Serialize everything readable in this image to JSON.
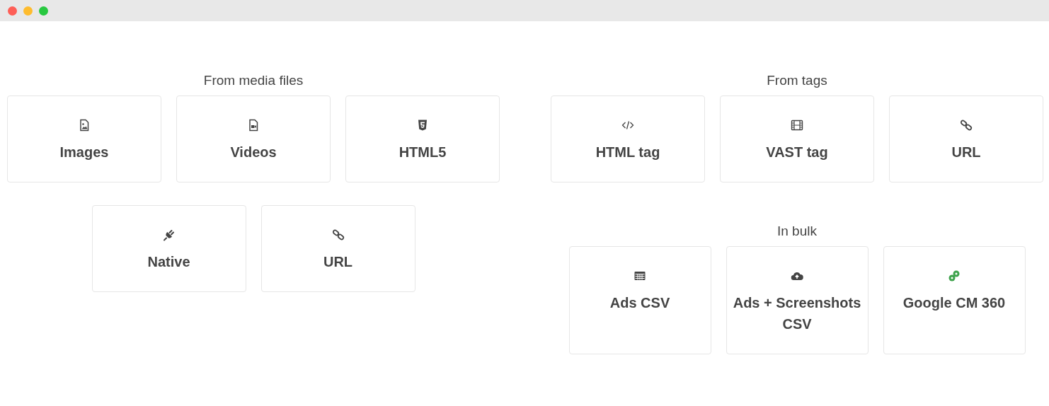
{
  "media_files": {
    "heading": "From media files",
    "rows": [
      [
        {
          "label": "Images",
          "kind": "image"
        },
        {
          "label": "Videos",
          "kind": "video"
        },
        {
          "label": "HTML5",
          "kind": "html5"
        }
      ],
      [
        {
          "label": "Native",
          "kind": "plug"
        },
        {
          "label": "URL",
          "kind": "link"
        }
      ]
    ]
  },
  "tags": {
    "heading": "From tags",
    "cards": [
      {
        "label": "HTML tag",
        "kind": "code"
      },
      {
        "label": "VAST tag",
        "kind": "film"
      },
      {
        "label": "URL",
        "kind": "link"
      }
    ]
  },
  "bulk": {
    "heading": "In bulk",
    "cards": [
      {
        "label": "Ads CSV",
        "kind": "table"
      },
      {
        "label": "Ads + Screenshots CSV",
        "kind": "cloud"
      },
      {
        "label": "Google CM 360",
        "kind": "cm360"
      }
    ]
  }
}
